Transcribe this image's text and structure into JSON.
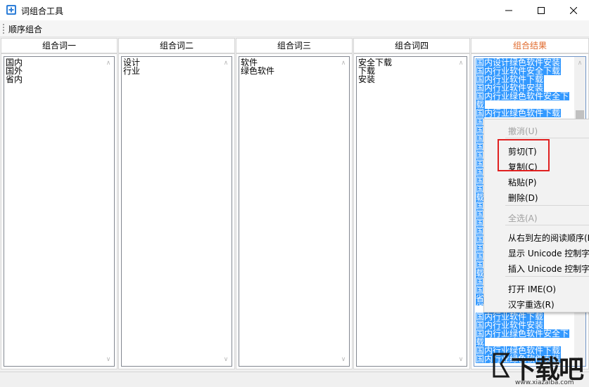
{
  "window": {
    "title": "词组合工具"
  },
  "toolbar": {
    "button_label": "顺序组合"
  },
  "columns": [
    {
      "header": "组合词一",
      "content": "国内\n国外\n省内"
    },
    {
      "header": "组合词二",
      "content": "设计\n行业"
    },
    {
      "header": "组合词三",
      "content": "软件\n绿色软件"
    },
    {
      "header": "组合词四",
      "content": "安全下载\n下载\n安装"
    }
  ],
  "result": {
    "header": "组合结果",
    "header_color": "#e06a2c",
    "top_lines": [
      "国内设计绿色软件安装",
      "国内行业软件安全下载",
      "国内行业软件下载",
      "国内行业软件安装",
      "国内行业绿色软件安全下",
      "载",
      "国内行业绿色软件下载"
    ],
    "left_strip": "国国国国国国国国国载国国国国国国国国载国国省省省省省省省载省省",
    "bottom_lines": [
      "国内行业软件下载",
      "国内行业软件安装",
      "国内行业绿色软件安全下",
      "载",
      "国内行业绿色软件下载",
      "国内行业绿色软件安装"
    ]
  },
  "context_menu": {
    "items": [
      {
        "label": "撤消(U)",
        "disabled": true
      },
      {
        "label": "剪切(T)",
        "disabled": false
      },
      {
        "label": "复制(C)",
        "disabled": false
      },
      {
        "label": "粘贴(P)",
        "disabled": false
      },
      {
        "label": "删除(D)",
        "disabled": false
      },
      {
        "label": "全选(A)",
        "disabled": true
      },
      {
        "label": "从右到左的阅读顺序(R)",
        "disabled": false
      },
      {
        "label": "显示 Unicode 控制字符(S)",
        "disabled": false
      },
      {
        "label": "插入 Unicode 控制字符(I)",
        "disabled": false
      },
      {
        "label": "打开 IME(O)",
        "disabled": false
      },
      {
        "label": "汉字重选(R)",
        "disabled": false
      }
    ]
  },
  "watermark": {
    "text": "下载吧",
    "url": "www.xiazaiba.com"
  },
  "colors": {
    "selection": "#3399ff",
    "highlight_box": "#e02020"
  }
}
